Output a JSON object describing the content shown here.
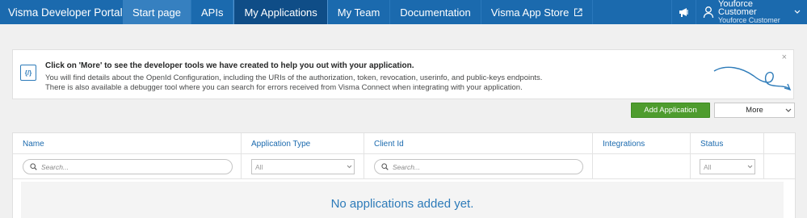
{
  "nav": {
    "brand": "Visma Developer Portal",
    "items": [
      {
        "label": "Start page"
      },
      {
        "label": "APIs"
      },
      {
        "label": "My Applications"
      },
      {
        "label": "My Team"
      },
      {
        "label": "Documentation"
      },
      {
        "label": "Visma App Store"
      }
    ],
    "user": {
      "name": "Youforce Customer",
      "org": "Youforce Customer"
    },
    "bar_color": "#1b6aae",
    "active_color": "#0f4d87"
  },
  "info": {
    "title": "Click on 'More' to see the developer tools we have created to help you out with your application.",
    "line1": "You will find details about the OpenId Configuration, including the URIs of the authorization, token, revocation, userinfo, and public-keys endpoints.",
    "line2": "There is also available a debugger tool where you can search for errors received from Visma Connect when integrating with your application.",
    "code_icon_text": "{/}",
    "close": "×"
  },
  "actions": {
    "add_label": "Add Application",
    "more_label": "More",
    "add_color": "#4e9c2e"
  },
  "table": {
    "columns": [
      "Name",
      "Application Type",
      "Client Id",
      "Integrations",
      "Status"
    ],
    "filters": {
      "name_placeholder": "Search...",
      "type_value": "All",
      "client_placeholder": "Search...",
      "status_value": "All"
    },
    "empty_text": "No applications added yet."
  }
}
